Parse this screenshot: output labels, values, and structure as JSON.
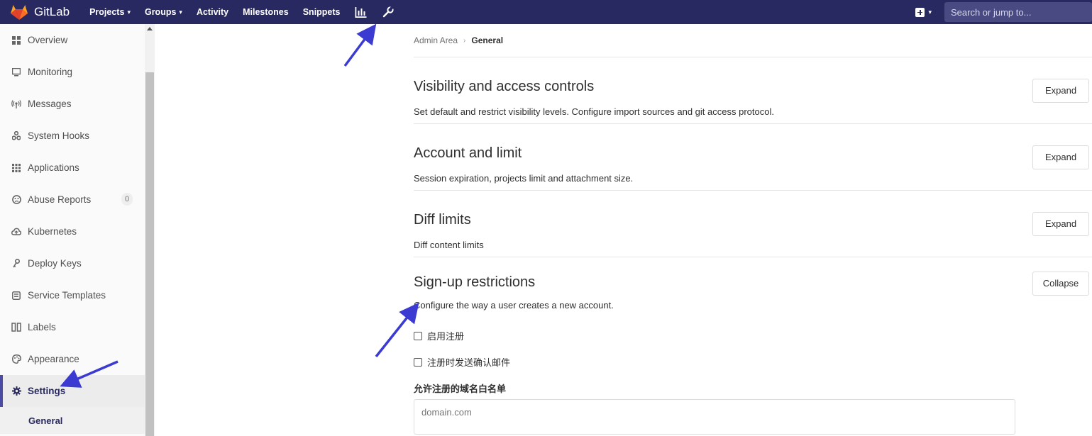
{
  "navbar": {
    "brand": "GitLab",
    "items": [
      {
        "label": "Projects",
        "caret": "⌄"
      },
      {
        "label": "Groups",
        "caret": "⌄"
      },
      {
        "label": "Activity"
      },
      {
        "label": "Milestones"
      },
      {
        "label": "Snippets"
      }
    ],
    "icons": [
      "chart-icon",
      "wrench-icon"
    ],
    "search_placeholder": "Search or jump to...",
    "colors": {
      "bg": "#292961",
      "search_bg": "#4a4a82"
    }
  },
  "sidebar": {
    "items": [
      {
        "label": "Overview",
        "icon": "grid-icon"
      },
      {
        "label": "Monitoring",
        "icon": "monitor-icon"
      },
      {
        "label": "Messages",
        "icon": "broadcast-icon"
      },
      {
        "label": "System Hooks",
        "icon": "hook-icon"
      },
      {
        "label": "Applications",
        "icon": "apps-icon"
      },
      {
        "label": "Abuse Reports",
        "icon": "abuse-icon",
        "badge": "0"
      },
      {
        "label": "Kubernetes",
        "icon": "cloud-icon"
      },
      {
        "label": "Deploy Keys",
        "icon": "key-icon"
      },
      {
        "label": "Service Templates",
        "icon": "template-icon"
      },
      {
        "label": "Labels",
        "icon": "label-icon"
      },
      {
        "label": "Appearance",
        "icon": "palette-icon"
      },
      {
        "label": "Settings",
        "icon": "gear-icon",
        "active": true
      }
    ],
    "sub_items": [
      {
        "label": "General"
      }
    ],
    "active_color": "#4b4ba3"
  },
  "breadcrumb": {
    "parent": "Admin Area",
    "current": "General"
  },
  "sections": [
    {
      "title": "Visibility and access controls",
      "desc": "Set default and restrict visibility levels. Configure import sources and git access protocol.",
      "button": "Expand"
    },
    {
      "title": "Account and limit",
      "desc": "Session expiration, projects limit and attachment size.",
      "button": "Expand"
    },
    {
      "title": "Diff limits",
      "desc": "Diff content limits",
      "button": "Expand"
    }
  ],
  "signup": {
    "title": "Sign-up restrictions",
    "desc": "Configure the way a user creates a new account.",
    "button": "Collapse",
    "checkboxes": [
      {
        "label": "启用注册",
        "checked": false
      },
      {
        "label": "注册时发送确认邮件",
        "checked": false
      }
    ],
    "whitelist_label": "允许注册的域名白名单",
    "whitelist_placeholder": "domain.com"
  },
  "annotation_color": "#3b3bd1"
}
